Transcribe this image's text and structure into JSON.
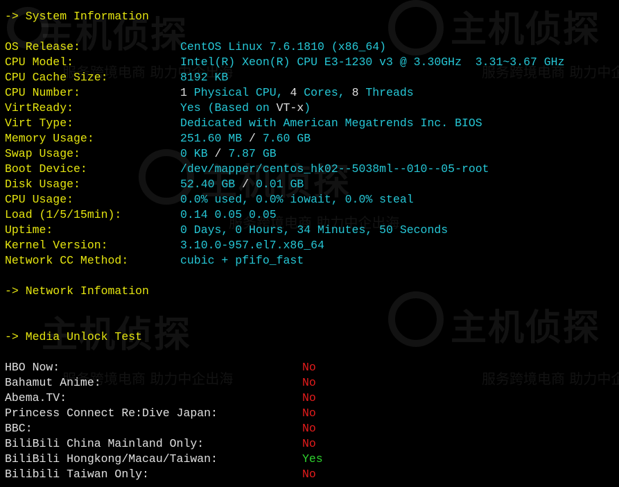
{
  "watermark": {
    "brand": "主机侦探",
    "slogan": "服务跨境电商 助力中企出海"
  },
  "sections": {
    "system": "-> System Information",
    "network": "-> Network Infomation",
    "media": "-> Media Unlock Test"
  },
  "system_info": [
    {
      "label": "OS Release:",
      "value": [
        {
          "t": "CentOS Linux 7.6.1810 (x86_64)",
          "c": "cyan"
        }
      ]
    },
    {
      "label": "CPU Model:",
      "value": [
        {
          "t": "Intel(R) Xeon(R) CPU E3-1230 v3 @ 3.30GHz  3.31~3.67 GHz",
          "c": "cyan"
        }
      ]
    },
    {
      "label": "CPU Cache Size:",
      "value": [
        {
          "t": "8192 KB",
          "c": "cyan"
        }
      ]
    },
    {
      "label": "CPU Number:",
      "value": [
        {
          "t": "1",
          "c": "white"
        },
        {
          "t": " Physical CPU, ",
          "c": "cyan"
        },
        {
          "t": "4",
          "c": "white"
        },
        {
          "t": " Cores, ",
          "c": "cyan"
        },
        {
          "t": "8",
          "c": "white"
        },
        {
          "t": " Threads",
          "c": "cyan"
        }
      ]
    },
    {
      "label": "VirtReady:",
      "value": [
        {
          "t": "Yes (Based on ",
          "c": "cyan"
        },
        {
          "t": "VT-x",
          "c": "white"
        },
        {
          "t": ")",
          "c": "cyan"
        }
      ]
    },
    {
      "label": "Virt Type:",
      "value": [
        {
          "t": "Dedicated with American Megatrends Inc. BIOS",
          "c": "cyan"
        }
      ]
    },
    {
      "label": "Memory Usage:",
      "value": [
        {
          "t": "251.60 MB",
          "c": "cyan"
        },
        {
          "t": " / ",
          "c": "white"
        },
        {
          "t": "7.60 GB",
          "c": "cyan"
        }
      ]
    },
    {
      "label": "Swap Usage:",
      "value": [
        {
          "t": "0 KB",
          "c": "cyan"
        },
        {
          "t": " / ",
          "c": "white"
        },
        {
          "t": "7.87 GB",
          "c": "cyan"
        }
      ]
    },
    {
      "label": "Boot Device:",
      "value": [
        {
          "t": "/dev/mapper/centos_hk02--5038ml--010--05-root",
          "c": "cyan"
        }
      ]
    },
    {
      "label": "Disk Usage:",
      "value": [
        {
          "t": "52.40 GB",
          "c": "cyan"
        },
        {
          "t": " / ",
          "c": "white"
        },
        {
          "t": "0.01 GB",
          "c": "cyan"
        }
      ]
    },
    {
      "label": "CPU Usage:",
      "value": [
        {
          "t": "0.0% used, 0.0% iowait, 0.0% steal",
          "c": "cyan"
        }
      ]
    },
    {
      "label": "Load (1/5/15min):",
      "value": [
        {
          "t": "0.14 0.05 0.05",
          "c": "cyan"
        }
      ]
    },
    {
      "label": "Uptime:",
      "value": [
        {
          "t": "0 Days, 0 Hours, 34 Minutes, 50 Seconds",
          "c": "cyan"
        }
      ]
    },
    {
      "label": "Kernel Version:",
      "value": [
        {
          "t": "3.10.0-957.el7.x86_64",
          "c": "cyan"
        }
      ]
    },
    {
      "label": "Network CC Method:",
      "value": [
        {
          "t": "cubic + pfifo_fast",
          "c": "cyan"
        }
      ]
    }
  ],
  "media_unlock": [
    {
      "label": "HBO Now:",
      "result": "No",
      "c": "red"
    },
    {
      "label": "Bahamut Anime:",
      "result": "No",
      "c": "red"
    },
    {
      "label": "Abema.TV:",
      "result": "No",
      "c": "red"
    },
    {
      "label": "Princess Connect Re:Dive Japan:",
      "result": "No",
      "c": "red"
    },
    {
      "label": "BBC:",
      "result": "No",
      "c": "red"
    },
    {
      "label": "BiliBili China Mainland Only:",
      "result": "No",
      "c": "red"
    },
    {
      "label": "BiliBili Hongkong/Macau/Taiwan:",
      "result": "Yes",
      "c": "green"
    },
    {
      "label": "Bilibili Taiwan Only:",
      "result": "No",
      "c": "red"
    }
  ],
  "colors": {
    "background": "#000000",
    "heading": "#e5e510",
    "value": "#26c7d6",
    "emphasis": "#e0e0e0",
    "fail": "#e51c1c",
    "pass": "#2ed22e"
  }
}
